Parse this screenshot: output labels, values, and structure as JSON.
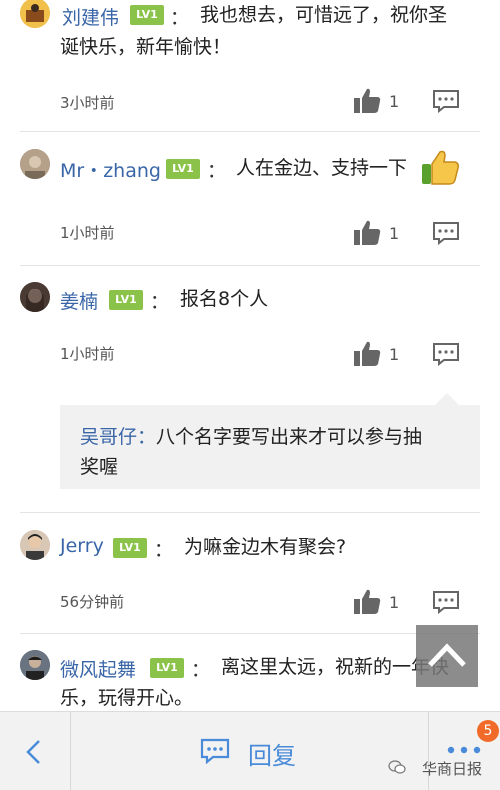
{
  "comments": [
    {
      "name": "刘建伟",
      "level": "LV1",
      "colon": "：",
      "text_line1": "我也想去，可惜远了，祝你圣",
      "text_line2": "诞快乐，新年愉快！",
      "time": "3小时前",
      "likes": "1"
    },
    {
      "name": "Mr・zhang",
      "level": "LV1",
      "colon": "：",
      "text_line1": "人在金边、支持一下",
      "time": "1小时前",
      "likes": "1"
    },
    {
      "name": "姜楠",
      "level": "LV1",
      "colon": "：",
      "text_line1": "报名8个人",
      "time": "1小时前",
      "likes": "1",
      "reply": {
        "name": "吴哥仔：",
        "text_line1": "八个名字要写出来才可以参与抽",
        "text_line2": "奖喔"
      }
    },
    {
      "name": "Jerry",
      "level": "LV1",
      "colon": "：",
      "text_line1": "为嘛金边木有聚会?",
      "time": "56分钟前",
      "likes": "1"
    },
    {
      "name": "微风起舞",
      "level": "LV1",
      "colon": "：",
      "text_line1": "离这里太远，祝新的一年快",
      "text_line2": "乐，玩得开心。"
    }
  ],
  "toolbar": {
    "reply_label": "回复",
    "badge_count": "5"
  },
  "watermark": "华商日报",
  "colors": {
    "name_blue": "#3a66a8",
    "level_green": "#8bc34a",
    "accent_blue": "#4a8bd9",
    "badge_orange": "#f26a2a"
  }
}
